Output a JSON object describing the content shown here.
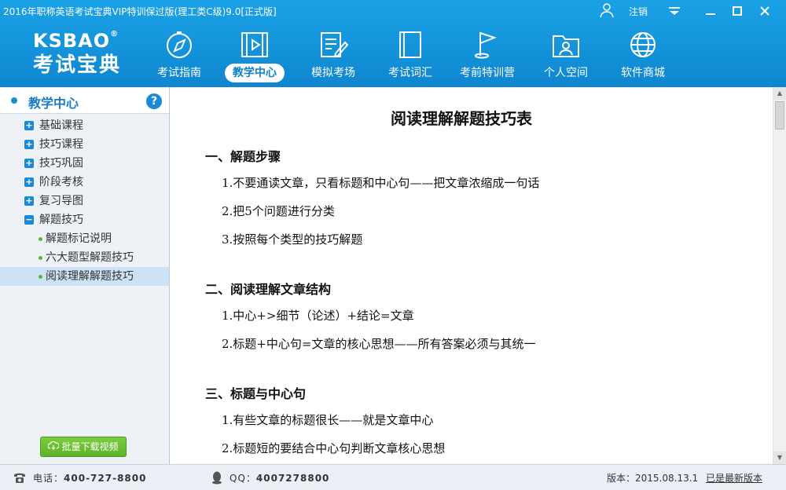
{
  "window": {
    "title": "2016年职称英语考试宝典VIP特训保过版(理工类C级)9.0[正式版]",
    "logout_label": "注销"
  },
  "logo": {
    "en": "KSBAO",
    "reg": "®",
    "cn": "考试宝典"
  },
  "nav": {
    "items": [
      {
        "label": "考试指南",
        "icon": "compass-icon"
      },
      {
        "label": "教学中心",
        "icon": "video-icon"
      },
      {
        "label": "模拟考场",
        "icon": "exam-paper-icon"
      },
      {
        "label": "考试词汇",
        "icon": "book-icon"
      },
      {
        "label": "考前特训营",
        "icon": "flag-icon"
      },
      {
        "label": "个人空间",
        "icon": "person-folder-icon"
      },
      {
        "label": "软件商城",
        "icon": "globe-icon"
      }
    ],
    "active_index": 1
  },
  "sidebar": {
    "title": "教学中心",
    "help_label": "?",
    "items": [
      {
        "label": "基础课程",
        "type": "group",
        "expanded": false
      },
      {
        "label": "技巧课程",
        "type": "group",
        "expanded": false
      },
      {
        "label": "技巧巩固",
        "type": "group",
        "expanded": false
      },
      {
        "label": "阶段考核",
        "type": "group",
        "expanded": false
      },
      {
        "label": "复习导图",
        "type": "group",
        "expanded": false
      },
      {
        "label": "解题技巧",
        "type": "group",
        "expanded": true
      },
      {
        "label": "解题标记说明",
        "type": "child"
      },
      {
        "label": "六大题型解题技巧",
        "type": "child"
      },
      {
        "label": "阅读理解解题技巧",
        "type": "child",
        "selected": true
      }
    ],
    "download_label": "批量下载视频"
  },
  "document": {
    "title": "阅读理解解题技巧表",
    "sections": [
      {
        "heading": "一、解题步骤",
        "lines": [
          "1.不要通读文章，只看标题和中心句——把文章浓缩成一句话",
          "2.把5个问题进行分类",
          "3.按照每个类型的技巧解题"
        ]
      },
      {
        "heading": "二、阅读理解文章结构",
        "lines": [
          "1.中心+>细节（论述）+结论=文章",
          "2.标题+中心句=文章的核心思想——所有答案必须与其统一"
        ]
      },
      {
        "heading": "三、标题与中心句",
        "lines": [
          "1.有些文章的标题很长——就是文章中心",
          "2.标题短的要结合中心句判断文章核心思想"
        ]
      }
    ]
  },
  "status": {
    "phone_label": "电话：",
    "phone": "400-727-8800",
    "qq_label": "QQ：",
    "qq": "4007278800",
    "version": "版本：2015.08.13.1",
    "latest": "已是最新版本"
  },
  "colors": {
    "header_blue": "#1392d9",
    "accent_green": "#5fb328",
    "selected_row": "#cde3f5"
  }
}
